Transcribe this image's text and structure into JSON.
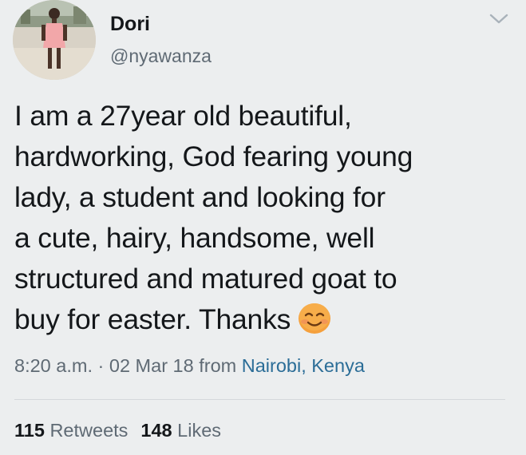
{
  "author": {
    "display_name": "Dori",
    "handle": "@nyawanza"
  },
  "tweet": {
    "lines": [
      "I am a 27year old beautiful,",
      "hardworking, God fearing young",
      "lady, a student and looking for",
      "a cute, hairy, handsome, well",
      "structured and matured goat to",
      "buy for easter. Thanks"
    ],
    "emoji": "smiling-face-emoji"
  },
  "meta": {
    "time": "8:20 a.m.",
    "separator": " · ",
    "date": "02 Mar 18",
    "from_label": " from ",
    "location": "Nairobi, Kenya"
  },
  "stats": {
    "retweets_count": "115",
    "retweets_label": "Retweets",
    "likes_count": "148",
    "likes_label": "Likes"
  },
  "colors": {
    "background": "#eceeef",
    "text": "#14171a",
    "secondary": "#5f6a74",
    "link": "#2b6d97"
  }
}
